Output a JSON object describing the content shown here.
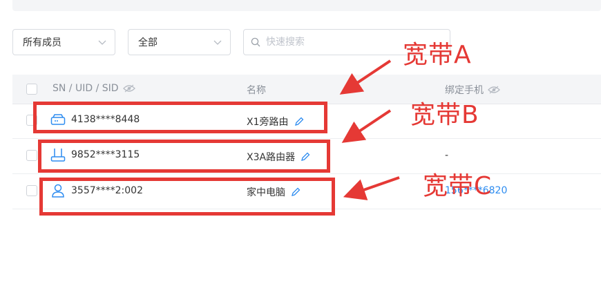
{
  "filters": {
    "member_select": "所有成员",
    "type_select": "全部",
    "search_placeholder": "快速搜索"
  },
  "table": {
    "columns": {
      "id": "SN / UID / SID",
      "name": "名称",
      "phone": "绑定手机"
    },
    "rows": [
      {
        "id": "4138****8448",
        "name": "X1旁路由",
        "phone": "",
        "icon": "router-box-icon"
      },
      {
        "id": "9852****3115",
        "name": "X3A路由器",
        "phone": "-",
        "icon": "router-antenna-icon"
      },
      {
        "id": "3557****2:002",
        "name": "家中电脑",
        "phone": "156****6820",
        "icon": "user-icon"
      }
    ]
  },
  "annotations": {
    "a": "宽带A",
    "b": "宽带B",
    "c": "宽带C",
    "color": "#e53935"
  }
}
